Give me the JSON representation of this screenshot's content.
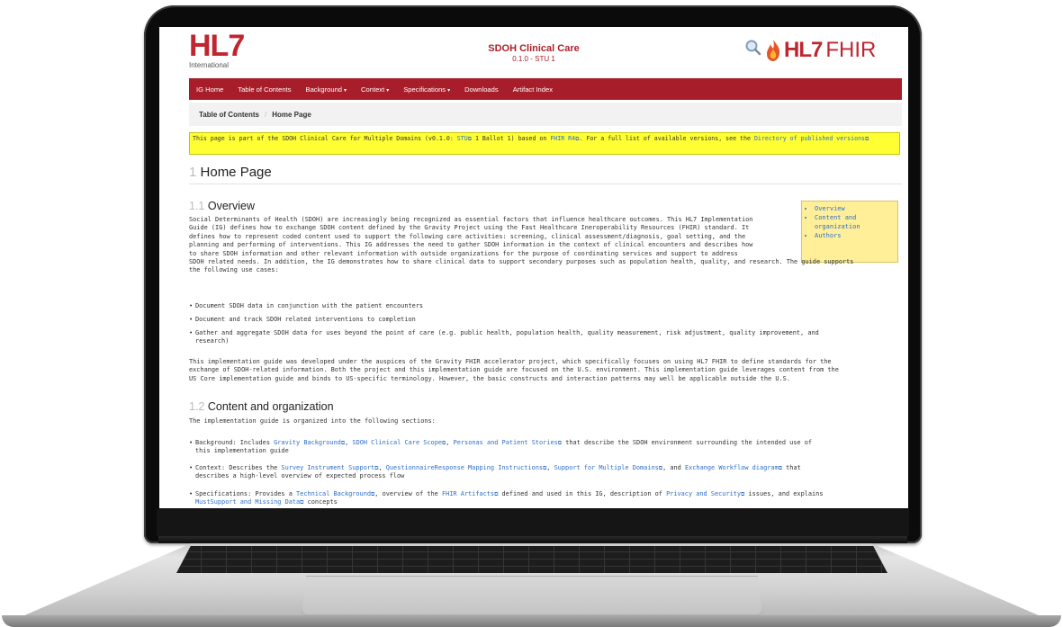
{
  "header": {
    "hl7_logo": "HL7",
    "hl7_sub": "International",
    "ig_title": "SDOH Clinical Care",
    "ig_version": "0.1.0 - STU 1",
    "fhir_logo_hl7": "HL7",
    "fhir_logo_fhir": "FHIR",
    "search_icon": "search-icon"
  },
  "nav": {
    "items": [
      "IG Home",
      "Table of Contents",
      "Background",
      "Context",
      "Specifications",
      "Downloads",
      "Artifact Index"
    ]
  },
  "breadcrumb": {
    "items": [
      "Table of Contents",
      "Home Page"
    ]
  },
  "notice": {
    "part1": "This page is part of the SDOH Clinical Care for Multiple Domains (v0.1.0: ",
    "link1": "STU",
    "part2": " 1 Ballot 1) based on ",
    "link2": "FHIR R4",
    "part3": ". For a full list of available versions, see the ",
    "link3": "Directory of published versions"
  },
  "page": {
    "title_num": "1",
    "title": "Home Page",
    "s1_num": "1.1",
    "s1_title": "Overview",
    "s2_num": "1.2",
    "s2_title": "Content and organization"
  },
  "toc": [
    "Overview",
    "Content and organization",
    "Authors"
  ],
  "overview": {
    "p1_l1": "Social Determinants of Health (SDOH) are increasingly being recognized as essential factors that influence healthcare outcomes. This HL7 Implementation",
    "p1_l2": "Guide (IG) defines how to exchange SDOH content defined by the Gravity Project using the Fast Healthcare Ineroperability Resources (FHIR) standard. It",
    "p1_l3": "defines how to represent coded content used to support the following care activities: screening, clinical assessment/diagnosis, goal setting, and the",
    "p1_l4": "planning and performing of interventions. This IG addresses the need to gather SDOH information in the context of clinical encounters and describes how",
    "p1_l5": "to share SDOH information and other relevant information with outside organizations for the purpose of coordinating services and support to address",
    "p1_l6": "SDOH related needs. In addition, the IG demonstrates how to share clinical data to support secondary purposes such as population health, quality, and research. The guide supports",
    "p1_l7": "the following use cases:",
    "b1": "Document SDOH data in conjunction with the patient encounters",
    "b2": "Document and track SDOH related interventions to completion",
    "b3_l1": "Gather and aggregate SDOH data for uses beyond the point of care (e.g. public health, population health, quality measurement, risk adjustment, quality improvement, and",
    "b3_l2": "research)",
    "p2_l1": "This implementation guide was developed under the auspices of the Gravity FHIR accelerator project, which specifically focuses on using HL7 FHIR to define standards for the",
    "p2_l2": "exchange of SDOH-related information. Both the project and this implementation guide are focused on the U.S. environment. This implementation guide leverages content from the",
    "p2_l3": "US Core implementation guide and binds to US-specific terminology. However, the basic constructs and interaction patterns may well be applicable outside the U.S."
  },
  "content": {
    "intro": "The implementation guide is organized into the following sections:",
    "bg_a": "Background: Includes ",
    "bg_l1": "Gravity Background",
    "bg_l2": "SDOH Clinical Care Scope",
    "bg_l3": "Personas and Patient Stories",
    "bg_b": " that describe the SDOH environment surrounding the intended use of",
    "bg_c": "this implementation guide",
    "ctx_a": "Context: Describes the ",
    "ctx_l1": "Survey Instrument Support",
    "ctx_l2": "QuestionnaireResponse Mapping Instructions",
    "ctx_l3": "Support for Multiple Domains",
    "ctx_m": ", and ",
    "ctx_l4": "Exchange Workflow diagram",
    "ctx_b": " that",
    "ctx_c": "describes a high-level overview of expected process flow",
    "spec_a": "Specifications: Provides a ",
    "spec_l1": "Technical Background",
    "spec_b": ", overview of the ",
    "spec_l2": "FHIR Artifacts",
    "spec_c": " defined and used in this IG, description of ",
    "spec_l3": "Privacy and Security",
    "spec_d": " issues, and explains",
    "spec_l4": "MustSupport and Missing Data",
    "spec_e": " concepts"
  },
  "colors": {
    "nav_bg": "#a71d2a",
    "brand_red": "#c0262f",
    "notice_bg": "#ffff33",
    "toc_bg": "#ffef99",
    "link": "#2f6fc5"
  }
}
